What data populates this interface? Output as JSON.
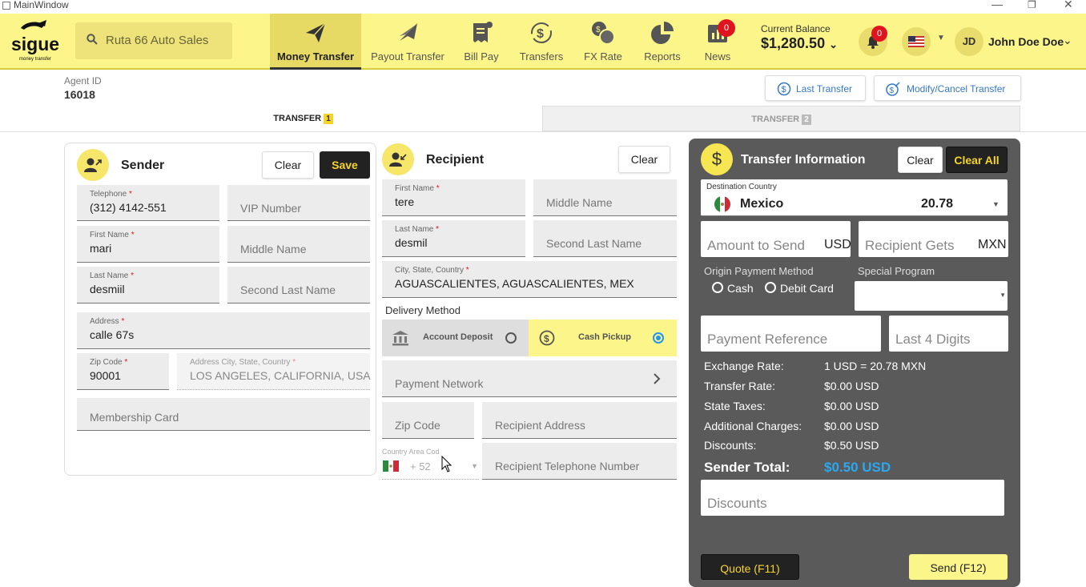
{
  "window": {
    "title": "MainWindow"
  },
  "nav": {
    "search_value": "Ruta 66 Auto Sales",
    "items": [
      {
        "label": "Money Transfer",
        "icon": "paper-plane-icon"
      },
      {
        "label": "Payout Transfer",
        "icon": "paper-plane-tilted-icon"
      },
      {
        "label": "Bill Pay",
        "icon": "receipt-icon"
      },
      {
        "label": "Transfers",
        "icon": "dollar-cycle-icon"
      },
      {
        "label": "FX Rate",
        "icon": "currency-exchange-icon"
      },
      {
        "label": "Reports",
        "icon": "pie-chart-icon"
      },
      {
        "label": "News",
        "icon": "bar-chart-icon",
        "badge": "0"
      }
    ],
    "balance_label": "Current Balance",
    "balance_value": "$1,280.50",
    "notification_badge": "0",
    "user_initials": "JD",
    "user_name": "John Doe Doe"
  },
  "agent": {
    "label": "Agent ID",
    "value": "16018"
  },
  "actions": {
    "last_transfer": "Last Transfer",
    "modify_cancel": "Modify/Cancel Transfer"
  },
  "tabs": [
    {
      "label": "TRANSFER",
      "num": "1"
    },
    {
      "label": "TRANSFER",
      "num": "2"
    }
  ],
  "sender": {
    "title": "Sender",
    "clear": "Clear",
    "save": "Save",
    "telephone": {
      "label": "Telephone",
      "value": "(312) 4142-551"
    },
    "vip": {
      "placeholder": "VIP Number"
    },
    "first_name": {
      "label": "First Name",
      "value": "mari"
    },
    "middle_name": {
      "placeholder": "Middle Name"
    },
    "last_name": {
      "label": "Last Name",
      "value": "desmiil"
    },
    "second_last_name": {
      "placeholder": "Second Last Name"
    },
    "address": {
      "label": "Address",
      "value": "calle 67s"
    },
    "zip": {
      "label": "Zip Code",
      "value": "90001"
    },
    "address_city": {
      "label": "Address City, State, Country",
      "value": "LOS ANGELES, CALIFORNIA, USA"
    },
    "membership": {
      "placeholder": "Membership Card"
    }
  },
  "recipient": {
    "title": "Recipient",
    "clear": "Clear",
    "first_name": {
      "label": "First Name",
      "value": "tere"
    },
    "middle_name": {
      "placeholder": "Middle Name"
    },
    "last_name": {
      "label": "Last Name",
      "value": "desmil"
    },
    "second_last_name": {
      "placeholder": "Second Last Name"
    },
    "city": {
      "label": "City, State, Country",
      "value": "AGUASCALIENTES, AGUASCALIENTES, MEX"
    },
    "delivery_label": "Delivery Method",
    "delivery": [
      {
        "label": "Account Deposit",
        "selected": false
      },
      {
        "label": "Cash Pickup",
        "selected": true
      }
    ],
    "payment_network": "Payment Network",
    "zip": {
      "placeholder": "Zip Code"
    },
    "address": {
      "placeholder": "Recipient Address"
    },
    "country_code_label": "Country Area Cod",
    "country_code": "+ 52",
    "phone": {
      "placeholder": "Recipient Telephone Number"
    }
  },
  "transfer": {
    "title": "Transfer Information",
    "clear": "Clear",
    "clear_all": "Clear All",
    "dest_label": "Destination Country",
    "dest_value": "Mexico",
    "dest_rate": "20.78",
    "amount_placeholder": "Amount to Send",
    "amount_currency": "USD",
    "gets_placeholder": "Recipient Gets",
    "gets_currency": "MXN",
    "origin_label": "Origin Payment Method",
    "origin_options": [
      "Cash",
      "Debit Card"
    ],
    "special_label": "Special Program",
    "payment_ref": "Payment Reference",
    "last4": "Last 4 Digits",
    "rows": [
      {
        "label": "Exchange Rate:",
        "value": "1 USD = 20.78 MXN"
      },
      {
        "label": "Transfer Rate:",
        "value": "$0.00 USD"
      },
      {
        "label": "State Taxes:",
        "value": "$0.00 USD"
      },
      {
        "label": "Additional Charges:",
        "value": "$0.00 USD"
      },
      {
        "label": "Discounts:",
        "value": "$0.50 USD"
      }
    ],
    "total_label": "Sender Total:",
    "total_value": "$0.50 USD",
    "discounts_placeholder": "Discounts",
    "quote": "Quote (F11)",
    "send": "Send (F12)"
  }
}
